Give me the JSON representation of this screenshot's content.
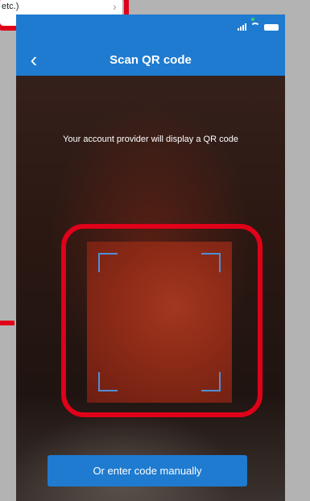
{
  "previous_step": {
    "card_text": "etc.)",
    "chevron": "chevron-right-icon"
  },
  "status_bar": {
    "icons": [
      "signal-icon",
      "wifi-icon",
      "battery-icon"
    ]
  },
  "nav": {
    "back_icon": "chevron-left-icon",
    "back_glyph": "‹",
    "title": "Scan QR code"
  },
  "scanner": {
    "instruction": "Your account provider will display a QR code"
  },
  "actions": {
    "manual_entry_label": "Or enter code manually"
  },
  "colors": {
    "brand_blue": "#1f7bd0",
    "annotation_red": "#e00019",
    "scan_corner_blue": "#4f8fd6"
  }
}
